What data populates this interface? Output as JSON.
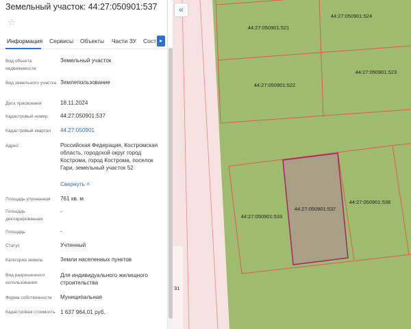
{
  "panel": {
    "title": "Земельный участок: 44:27:050901:537",
    "favorite_icon": "star-outline-icon"
  },
  "tabs": [
    {
      "label": "Информация",
      "active": true
    },
    {
      "label": "Сервисы",
      "active": false
    },
    {
      "label": "Объекты",
      "active": false
    },
    {
      "label": "Части ЗУ",
      "active": false
    },
    {
      "label": "Сост",
      "active": false
    }
  ],
  "tabs_next_icon": "chevron-right-icon",
  "info": {
    "object_type": {
      "label": "Вид объекта недвижимости",
      "value": "Земельный участок"
    },
    "land_type": {
      "label": "Вид земельного участка",
      "value": "Землепользование"
    },
    "assigned_date": {
      "label": "Дата присвоения",
      "value": "18.11.2024"
    },
    "cadastral_number": {
      "label": "Кадастровый номер",
      "value": "44:27:050901:537"
    },
    "cadastral_block": {
      "label": "Кадастровый квартал",
      "value": "44:27:050901"
    },
    "address": {
      "label": "Адрес",
      "value": "Российская Федерация, Костромская область, городской округ город Кострома, город Кострома, поселок Гари, земельный участок 52",
      "toggle": "Свернуть"
    },
    "area_specified": {
      "label": "Площадь уточненная",
      "value": "761 кв. м"
    },
    "area_declared": {
      "label": "Площадь декларированная",
      "value": "-"
    },
    "area": {
      "label": "Площадь",
      "value": "-"
    },
    "status": {
      "label": "Статус",
      "value": "Учтенный"
    },
    "land_category": {
      "label": "Категория земель",
      "value": "Земли населенных пунктов"
    },
    "permitted_use": {
      "label": "Вид разрешенного использования",
      "value": "Для индивидуального жилищного строительства"
    },
    "ownership_form": {
      "label": "Форма собственности",
      "value": "Муниципальная"
    },
    "cadastral_value": {
      "label": "Кадастровая стоимость",
      "value": "1 637 964,01 руб."
    }
  },
  "map": {
    "collapse_icon": "double-chevron-left-icon",
    "parcel_labels": {
      "p521": "44:27:050901:521",
      "p524": "44:27:050901:524",
      "p522": "44:27:050901:522",
      "p523": "44:27:050901:523",
      "p537": "44:27:050901:537",
      "p538": "44:27:050901:538",
      "p533": "44:27:050901:533",
      "edge": "31"
    },
    "colors": {
      "land": "#9fbc6e",
      "road": "#f6e2e2",
      "boundary": "#e0584e",
      "selected_fill": "#a89f84",
      "selected_border": "#a4226e"
    }
  }
}
